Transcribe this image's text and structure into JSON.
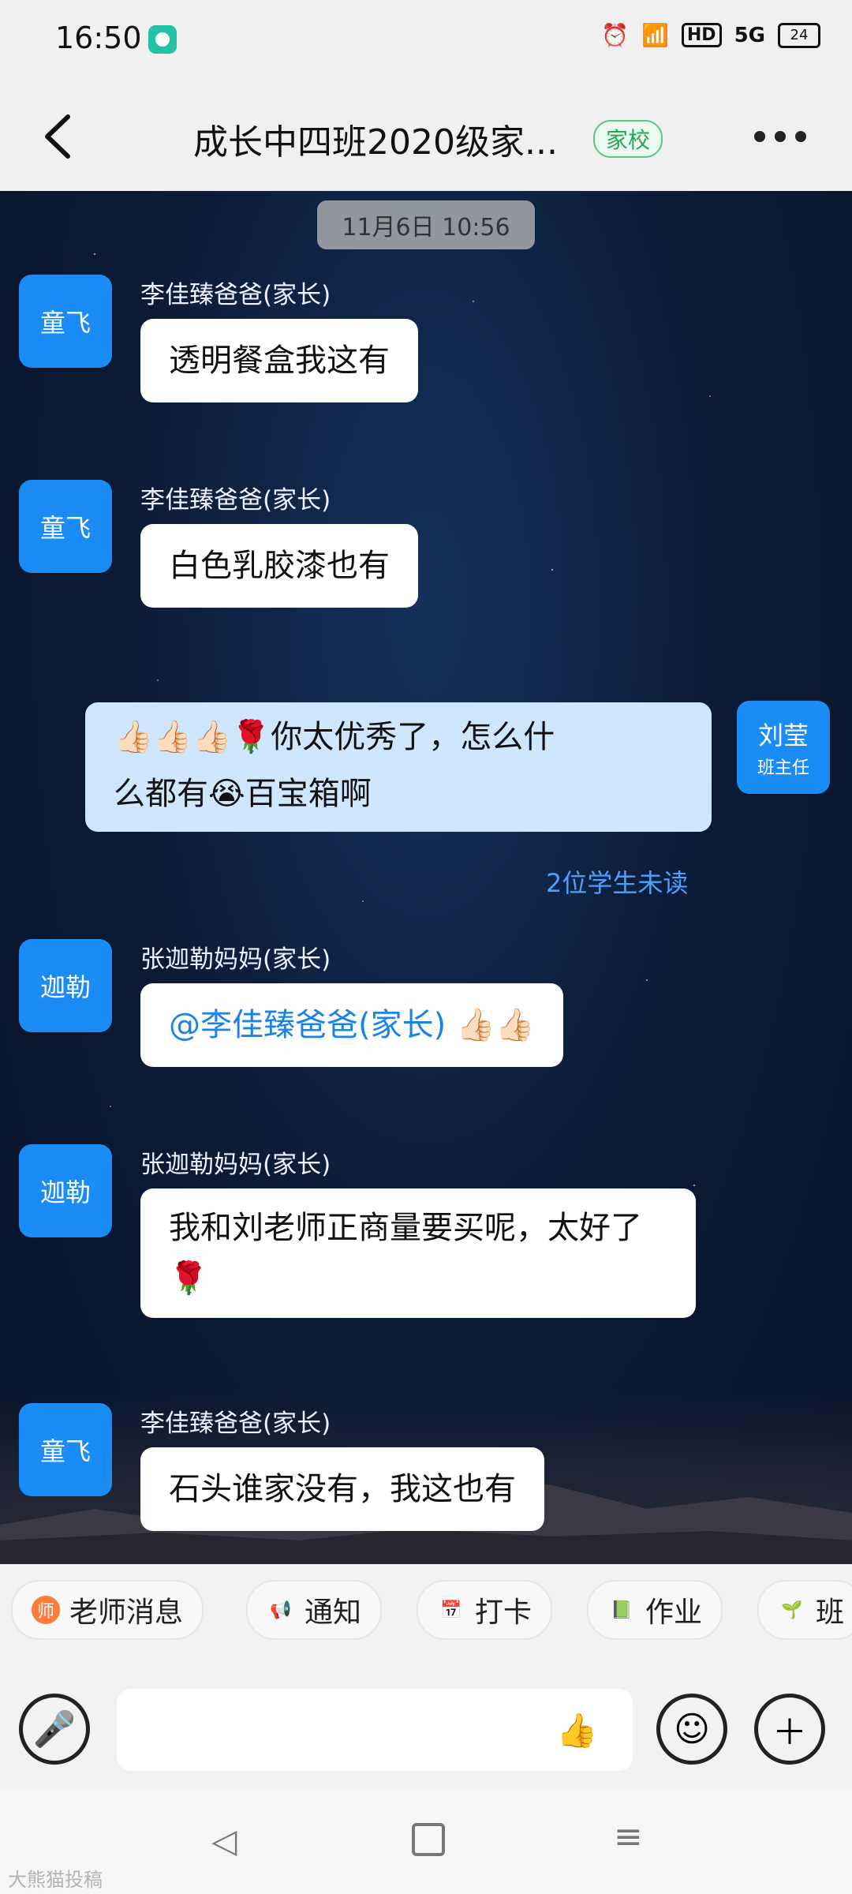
{
  "status": {
    "time": "16:50",
    "hd": "HD",
    "signal": "5G",
    "battery": "24"
  },
  "header": {
    "title": "成长中四班2020级家...",
    "tag": "家校"
  },
  "chat": {
    "timestamp": "11月6日 10:56",
    "messages": [
      {
        "avatar": "童飞",
        "sender": "李佳臻爸爸(家长)",
        "text": "透明餐盒我这有"
      },
      {
        "avatar": "童飞",
        "sender": "李佳臻爸爸(家长)",
        "text": "白色乳胶漆也有"
      },
      {
        "avatar": "刘莹",
        "avatar_role": "班主任",
        "line1": "👍🏻👍🏻👍🏻🌹你太优秀了，怎么什",
        "line2": "么都有😭百宝箱啊",
        "status": "2位学生未读"
      },
      {
        "avatar": "迦勒",
        "sender": "张迦勒妈妈(家长)",
        "mention": "@李佳臻爸爸(家长)",
        "emoji": "👍🏻👍🏻"
      },
      {
        "avatar": "迦勒",
        "sender": "张迦勒妈妈(家长)",
        "line1": "我和刘老师正商量要买呢，太好了",
        "line2": "🌹"
      },
      {
        "avatar": "童飞",
        "sender": "李佳臻爸爸(家长)",
        "text": "石头谁家没有，我这也有"
      }
    ]
  },
  "quickbar": {
    "chips": [
      "老师消息",
      "通知",
      "打卡",
      "作业",
      "班"
    ]
  },
  "watermark": "大熊猫投稿"
}
